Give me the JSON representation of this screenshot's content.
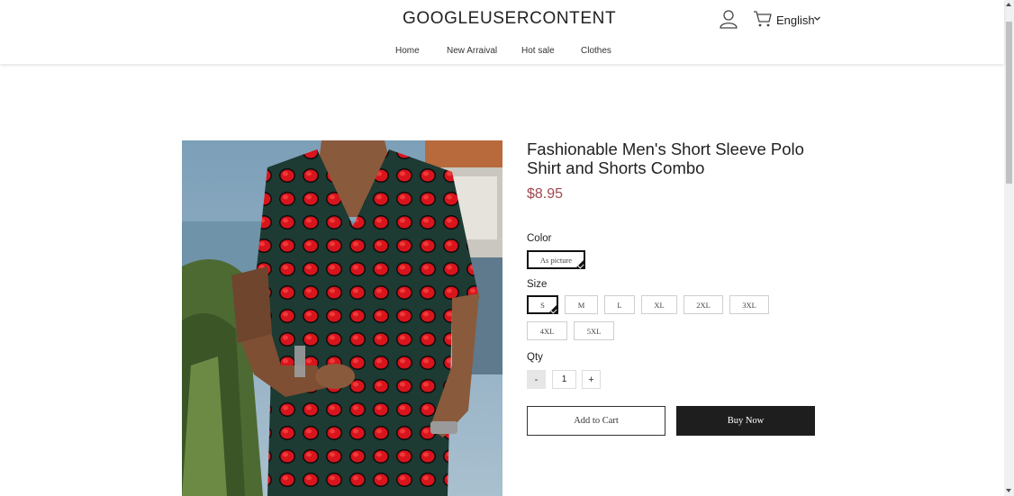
{
  "header": {
    "logo": "GOOGLEUSERCONTENT",
    "language": "English",
    "icons": {
      "account": "user-icon",
      "cart": "cart-icon",
      "language_dropdown": "chevron-down-icon"
    }
  },
  "nav": [
    {
      "label": "Home"
    },
    {
      "label": "New Arraival"
    },
    {
      "label": "Hot sale"
    },
    {
      "label": "Clothes"
    }
  ],
  "product": {
    "title": "Fashionable Men's Short Sleeve Polo Shirt and Shorts Combo",
    "price": "$8.95",
    "color_label": "Color",
    "colors": [
      {
        "label": "As picture",
        "selected": true
      }
    ],
    "size_label": "Size",
    "sizes": [
      {
        "label": "S",
        "selected": true
      },
      {
        "label": "M"
      },
      {
        "label": "L"
      },
      {
        "label": "XL"
      },
      {
        "label": "2XL"
      },
      {
        "label": "3XL"
      },
      {
        "label": "4XL"
      },
      {
        "label": "5XL"
      }
    ],
    "qty_label": "Qty",
    "qty_minus": "-",
    "qty_value": "1",
    "qty_plus": "+",
    "add_to_cart": "Add to Cart",
    "buy_now": "Buy Now"
  },
  "colors": {
    "price": "#a04850",
    "buy_button_bg": "#1e1e1e",
    "selected_border": "#111111"
  }
}
